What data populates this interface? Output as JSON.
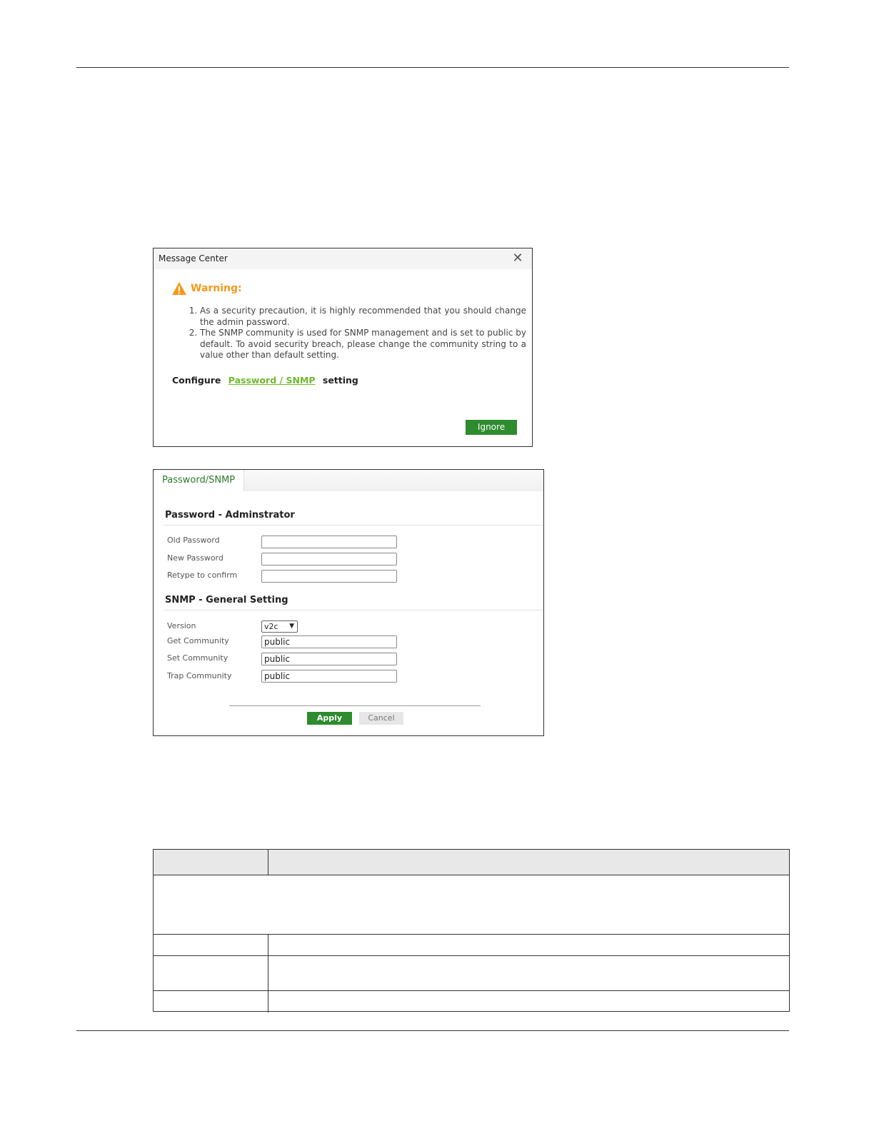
{
  "message_center": {
    "title": "Message Center",
    "close_icon": "close-icon",
    "warning_label": "Warning:",
    "warning_icon": "warning-triangle-icon",
    "items": [
      "As a security precaution, it is highly recommended that you should change the admin password.",
      "The SNMP community is used for SNMP management and is set to public by default. To avoid security breach, please change the community string to a value other than default setting."
    ],
    "configure_prefix": "Configure",
    "configure_link": "Password / SNMP",
    "configure_suffix": "setting",
    "ignore_label": "Ignore"
  },
  "password_snmp": {
    "tab_label": "Password/SNMP",
    "admin_section": "Password - Adminstrator",
    "old_password_label": "Old Password",
    "new_password_label": "New Password",
    "retype_label": "Retype to confirm",
    "snmp_section": "SNMP - General Setting",
    "version_label": "Version",
    "version_value": "v2c",
    "get_community_label": "Get Community",
    "get_community_value": "public",
    "set_community_label": "Set Community",
    "set_community_value": "public",
    "trap_community_label": "Trap Community",
    "trap_community_value": "public",
    "apply_label": "Apply",
    "cancel_label": "Cancel"
  },
  "colors": {
    "accent_green": "#2e8b2e",
    "link_green": "#6fba2c",
    "warning_orange": "#f39a1c"
  }
}
